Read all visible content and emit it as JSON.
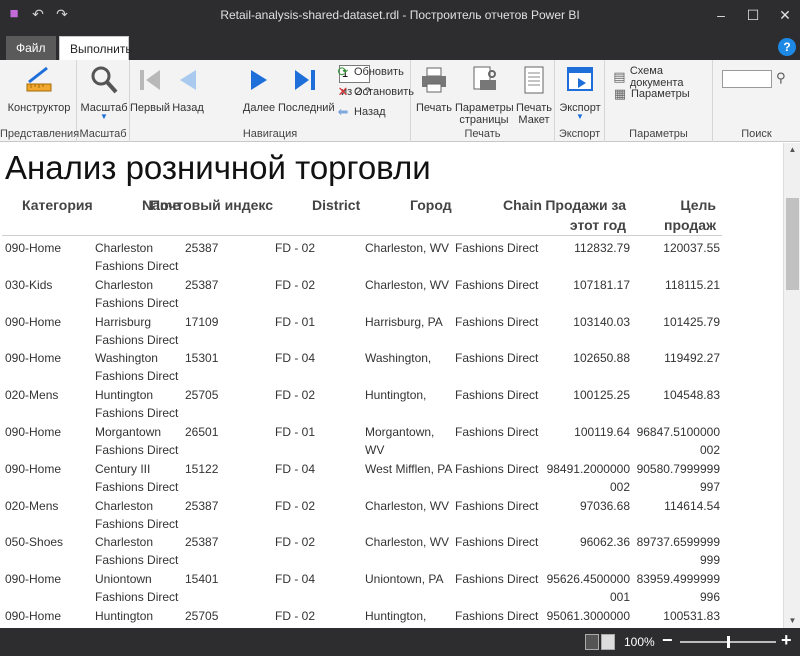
{
  "window": {
    "title": "Retail-analysis-shared-dataset.rdl - Построитель отчетов Power BI"
  },
  "tabs": {
    "file": "Файл",
    "run": "Выполнить",
    "help": "?"
  },
  "ribbon": {
    "design": "Конструктор",
    "zoom": "Масштаб",
    "first": "Первый",
    "back": "Назад",
    "page_value": "1",
    "page_of": "из 2 ?",
    "next": "Далее",
    "last": "Последний",
    "refresh": "Обновить",
    "stop": "Остановить",
    "back_small": "Назад",
    "print": "Печать",
    "page_setup": "Параметры страницы",
    "print_layout": "Печать Макет",
    "export": "Экспорт",
    "doc_map": "Схема документа",
    "params": "Параметры",
    "groups": {
      "views": "Представления",
      "zoom": "Масштаб",
      "navigation": "Навигация",
      "print": "Печать",
      "export": "Экспорт",
      "params": "Параметры",
      "search": "Поиск"
    }
  },
  "report": {
    "title": "Анализ розничной торговли",
    "headers": {
      "category": "Категория",
      "name": "Name",
      "zip": "Почтовый индекс",
      "district": "District",
      "city": "Город",
      "chain": "Chain",
      "sales": "Продажи за этот год",
      "goal": "Цель продаж"
    },
    "rows": [
      {
        "category": "090-Home",
        "name": "Charleston Fashions Direct",
        "zip": "25387",
        "district": "FD - 02",
        "city": "Charleston, WV",
        "chain": "Fashions Direct",
        "sales": "112832.79",
        "goal": "120037.55"
      },
      {
        "category": "030-Kids",
        "name": "Charleston Fashions Direct",
        "zip": "25387",
        "district": "FD - 02",
        "city": "Charleston, WV",
        "chain": "Fashions Direct",
        "sales": "107181.17",
        "goal": "118115.21"
      },
      {
        "category": "090-Home",
        "name": "Harrisburg Fashions Direct",
        "zip": "17109",
        "district": "FD - 01",
        "city": "Harrisburg, PA",
        "chain": "Fashions Direct",
        "sales": "103140.03",
        "goal": "101425.79"
      },
      {
        "category": "090-Home",
        "name": "Washington Fashions Direct",
        "zip": "15301",
        "district": "FD - 04",
        "city": "Washington,",
        "chain": "Fashions Direct",
        "sales": "102650.88",
        "goal": "119492.27"
      },
      {
        "category": "020-Mens",
        "name": "Huntington Fashions Direct",
        "zip": "25705",
        "district": "FD - 02",
        "city": "Huntington,",
        "chain": "Fashions Direct",
        "sales": "100125.25",
        "goal": "104548.83"
      },
      {
        "category": "090-Home",
        "name": "Morgantown Fashions Direct",
        "zip": "26501",
        "district": "FD - 01",
        "city": "Morgantown, WV",
        "chain": "Fashions Direct",
        "sales": "100119.64",
        "goal": "96847.5100000 002"
      },
      {
        "category": "090-Home",
        "name": "Century III Fashions Direct",
        "zip": "15122",
        "district": "FD - 04",
        "city": "West Mifflen, PA",
        "chain": "Fashions Direct",
        "sales": "98491.2000000 002",
        "goal": "90580.7999999 997"
      },
      {
        "category": "020-Mens",
        "name": "Charleston Fashions Direct",
        "zip": "25387",
        "district": "FD - 02",
        "city": "Charleston, WV",
        "chain": "Fashions Direct",
        "sales": "97036.68",
        "goal": "114614.54"
      },
      {
        "category": "050-Shoes",
        "name": "Charleston Fashions Direct",
        "zip": "25387",
        "district": "FD - 02",
        "city": "Charleston, WV",
        "chain": "Fashions Direct",
        "sales": "96062.36",
        "goal": "89737.6599999 999"
      },
      {
        "category": "090-Home",
        "name": "Uniontown Fashions Direct",
        "zip": "15401",
        "district": "FD - 04",
        "city": "Uniontown, PA",
        "chain": "Fashions Direct",
        "sales": "95626.4500000 001",
        "goal": "83959.4999999 996"
      },
      {
        "category": "090-Home",
        "name": "Huntington Fashions Direct",
        "zip": "25705",
        "district": "FD - 02",
        "city": "Huntington,",
        "chain": "Fashions Direct",
        "sales": "95061.3000000",
        "goal": "100531.83"
      }
    ]
  },
  "status": {
    "zoom": "100%",
    "zoom_level": 0.5
  },
  "colors": {
    "chrome": "#2d2d30",
    "ribbon": "#f3f3f3",
    "accent": "#1e6fd9"
  }
}
